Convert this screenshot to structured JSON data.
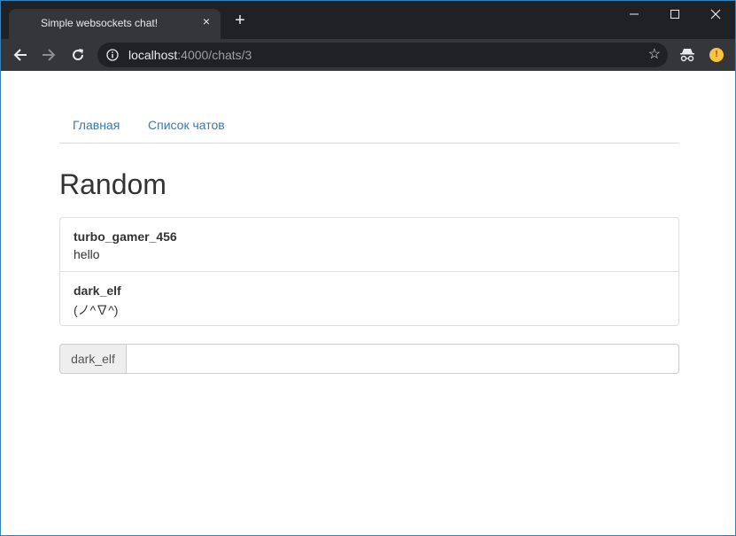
{
  "browser": {
    "tab_title": "Simple websockets chat!",
    "tab_close_icon": "×",
    "new_tab_icon": "+",
    "url_host": "localhost",
    "url_rest": ":4000/chats/3",
    "star_icon": "☆",
    "profile_initial": "!"
  },
  "nav": {
    "items": [
      {
        "label": "Главная"
      },
      {
        "label": "Список чатов"
      }
    ]
  },
  "chat": {
    "title": "Random",
    "messages": [
      {
        "user": "turbo_gamer_456",
        "text": "hello"
      },
      {
        "user": "dark_elf",
        "text": "(ノ^∇^)"
      }
    ]
  },
  "composer": {
    "username": "dark_elf",
    "value": "",
    "placeholder": ""
  },
  "colors": {
    "link": "#337ab7",
    "frame": "#202124",
    "toolbar": "#35363a"
  }
}
